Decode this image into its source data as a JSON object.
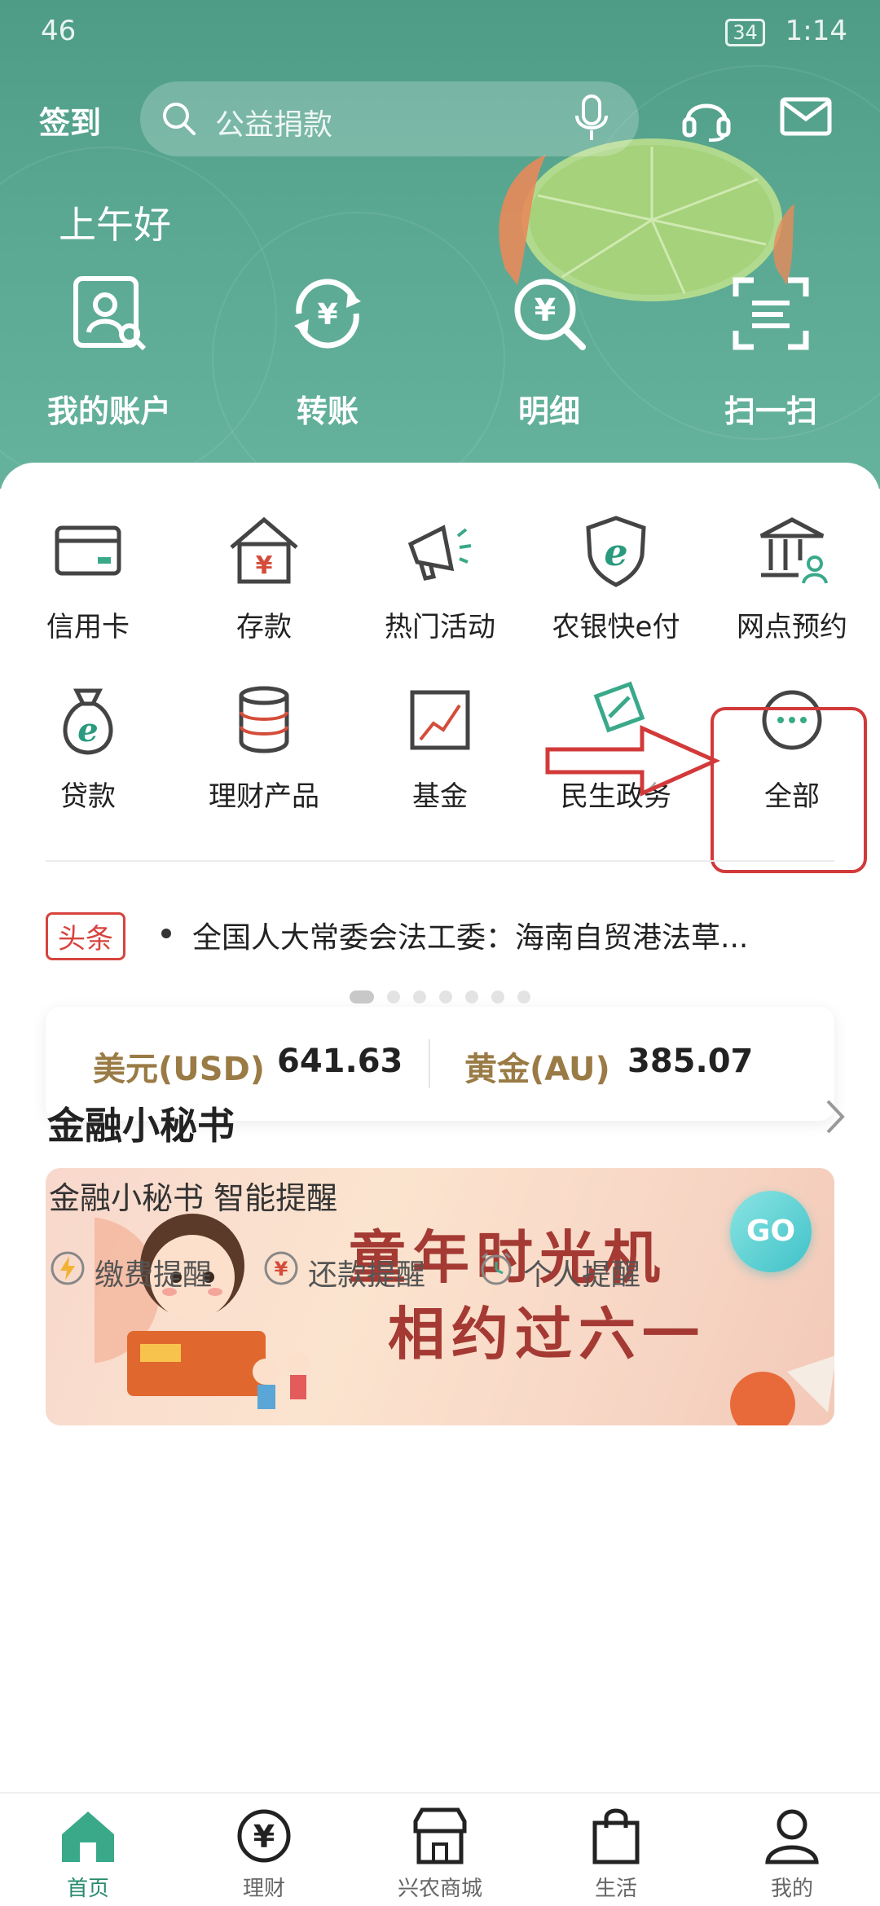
{
  "status_bar": {
    "network": "46",
    "battery": "34",
    "time": "1:14"
  },
  "topbar": {
    "signin_label": "签到",
    "search_placeholder": "公益捐款"
  },
  "greeting": "上午好",
  "quick_actions": [
    {
      "label": "我的账户",
      "icon": "account-search-icon"
    },
    {
      "label": "转账",
      "icon": "transfer-icon"
    },
    {
      "label": "明细",
      "icon": "details-icon"
    },
    {
      "label": "扫一扫",
      "icon": "scan-icon"
    }
  ],
  "services": [
    {
      "label": "信用卡",
      "icon": "credit-card-icon"
    },
    {
      "label": "存款",
      "icon": "deposit-house-icon"
    },
    {
      "label": "热门活动",
      "icon": "megaphone-icon"
    },
    {
      "label": "农银快e付",
      "icon": "e-pay-shield-icon"
    },
    {
      "label": "网点预约",
      "icon": "bank-branch-icon"
    },
    {
      "label": "贷款",
      "icon": "loan-bag-icon"
    },
    {
      "label": "理财产品",
      "icon": "coins-stack-icon"
    },
    {
      "label": "基金",
      "icon": "fund-chart-icon"
    },
    {
      "label": "民生政务",
      "icon": "gov-services-icon"
    },
    {
      "label": "全部",
      "icon": "more-dots-icon"
    }
  ],
  "news": {
    "tag": "头条",
    "text": "全国人大常委会法工委：海南自贸港法草..."
  },
  "rates": [
    {
      "name": "美元(USD)",
      "value": "641.63"
    },
    {
      "name": "黄金(AU)",
      "value": "385.07"
    }
  ],
  "banner": {
    "line1": "童年时光机",
    "line2": "相约过六一",
    "carousel_total": 7,
    "carousel_active": 1
  },
  "finance_secretary": {
    "title": "金融小秘书",
    "subtitle": "金融小秘书 智能提醒",
    "reminders": [
      {
        "label": "缴费提醒",
        "icon": "bolt-icon"
      },
      {
        "label": "还款提醒",
        "icon": "yen-circle-icon"
      },
      {
        "label": "个人提醒",
        "icon": "alarm-clock-icon"
      }
    ]
  },
  "go_button": "GO",
  "bottom_nav": [
    {
      "label": "首页",
      "icon": "home-icon",
      "active": true
    },
    {
      "label": "理财",
      "icon": "yen-icon",
      "active": false
    },
    {
      "label": "兴农商城",
      "icon": "store-icon",
      "active": false
    },
    {
      "label": "生活",
      "icon": "shopping-bag-icon",
      "active": false
    },
    {
      "label": "我的",
      "icon": "user-icon",
      "active": false
    }
  ],
  "colors": {
    "header_green": "#5aa892",
    "accent_red": "#d23a3a",
    "gold_label": "#9a7b45",
    "nav_active": "#2a8a6e"
  }
}
